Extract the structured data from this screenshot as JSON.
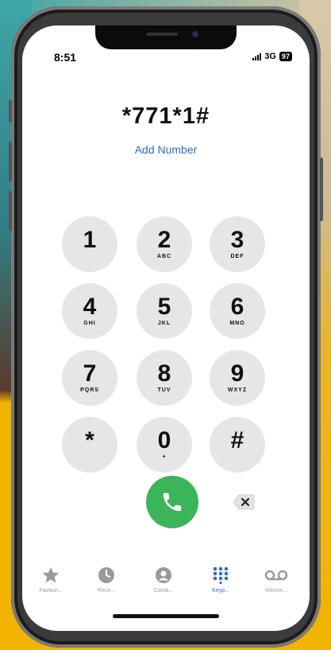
{
  "status": {
    "time": "8:51",
    "network": "3G",
    "battery": "97"
  },
  "dialer": {
    "number": "*771*1#",
    "add_number": "Add Number",
    "keys": [
      {
        "digit": "1",
        "letters": ""
      },
      {
        "digit": "2",
        "letters": "ABC"
      },
      {
        "digit": "3",
        "letters": "DEF"
      },
      {
        "digit": "4",
        "letters": "GHI"
      },
      {
        "digit": "5",
        "letters": "JKL"
      },
      {
        "digit": "6",
        "letters": "MNO"
      },
      {
        "digit": "7",
        "letters": "PQRS"
      },
      {
        "digit": "8",
        "letters": "TUV"
      },
      {
        "digit": "9",
        "letters": "WXYZ"
      },
      {
        "digit": "*",
        "letters": ""
      },
      {
        "digit": "0",
        "letters": "+"
      },
      {
        "digit": "#",
        "letters": ""
      }
    ]
  },
  "tabs": [
    {
      "label": "Favouri...",
      "icon": "star-icon",
      "active": false
    },
    {
      "label": "Rece...",
      "icon": "clock-icon",
      "active": false
    },
    {
      "label": "Conta...",
      "icon": "contact-icon",
      "active": false
    },
    {
      "label": "Keyp...",
      "icon": "keypad-icon",
      "active": true
    },
    {
      "label": "Voicem...",
      "icon": "voicemail-icon",
      "active": false
    }
  ],
  "colors": {
    "accent": "#2f6ec0",
    "call": "#3cb45a",
    "key_bg": "#e6e6e6",
    "frame": "#3b3b3b",
    "background_yellow": "#f2b400"
  }
}
